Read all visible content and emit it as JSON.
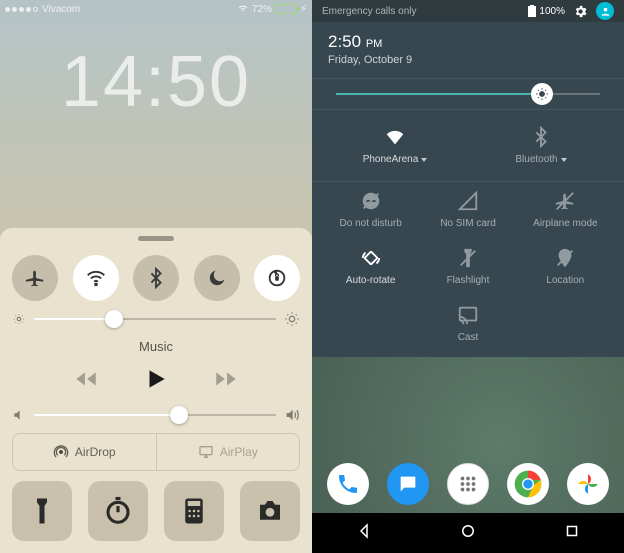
{
  "ios": {
    "status": {
      "carrier": "Vivacom",
      "wifi_icon": "wifi",
      "battery_pct": "72%"
    },
    "clock": "14:50",
    "cc": {
      "toggles": {
        "airplane": {
          "on": false
        },
        "wifi": {
          "on": true
        },
        "bluetooth": {
          "on": false
        },
        "dnd": {
          "on": false
        },
        "rotation_lock": {
          "on": true
        }
      },
      "brightness_pct": 33,
      "music_label": "Music",
      "volume_pct": 60,
      "airdrop_label": "AirDrop",
      "airplay_label": "AirPlay"
    }
  },
  "android": {
    "status": {
      "left_text": "Emergency calls only",
      "battery_pct": "100%"
    },
    "time": "2:50",
    "ampm": "PM",
    "date": "Friday, October 9",
    "brightness_pct": 78,
    "wifi_label": "PhoneArena",
    "bt_label": "Bluetooth",
    "tiles": {
      "dnd": "Do not disturb",
      "sim": "No SIM card",
      "airplane": "Airplane mode",
      "rotate": "Auto-rotate",
      "flash": "Flashlight",
      "location": "Location",
      "cast": "Cast"
    }
  }
}
